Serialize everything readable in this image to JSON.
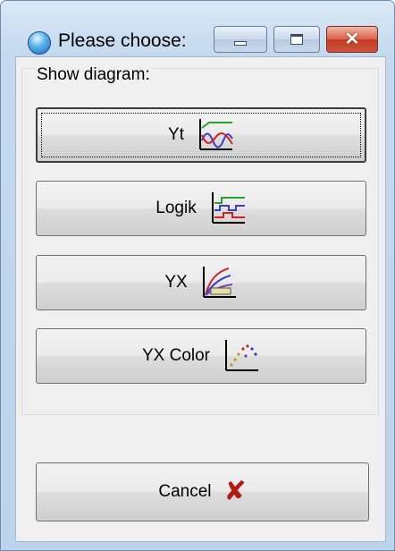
{
  "window": {
    "title": "Please choose:",
    "icons": {
      "app": "app-globe-icon",
      "minimize": "minimize-icon",
      "maximize": "maximize-icon",
      "close": "close-icon"
    }
  },
  "group": {
    "label": "Show diagram:"
  },
  "buttons": {
    "yt": {
      "label": "Yt",
      "icon": "yt-chart-icon"
    },
    "logik": {
      "label": "Logik",
      "icon": "logic-chart-icon"
    },
    "yx": {
      "label": "YX",
      "icon": "yx-chart-icon"
    },
    "yx_color": {
      "label": "YX Color",
      "icon": "scatter-chart-icon"
    },
    "cancel": {
      "label": "Cancel",
      "icon": "cancel-x-icon"
    }
  },
  "colors": {
    "accent_red": "#b21d12",
    "titlebar": "#c4d9ef"
  }
}
